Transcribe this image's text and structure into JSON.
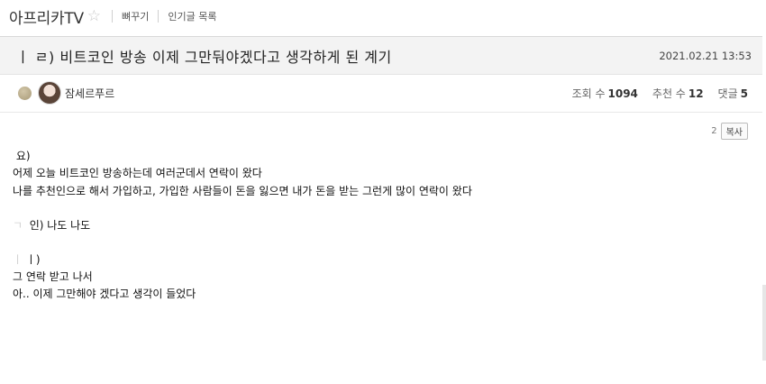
{
  "topbar": {
    "board_title": "아프리카TV",
    "star_icon": "☆",
    "links": [
      "뼈꾸기",
      "인기글 목록"
    ]
  },
  "post": {
    "title": "ㅣ  ㄹ) 비트코인 방송 이제 그만둬야겠다고 생각하게 된 계기",
    "date": "2021.02.21 13:53",
    "author": "잠세르푸르"
  },
  "stats": {
    "views_label": "조회 수",
    "views": "1094",
    "recommend_label": "추천 수",
    "recommend": "12",
    "comments_label": "댓글",
    "comments": "5"
  },
  "copy": {
    "number": "2",
    "button": "복사"
  },
  "content": {
    "lines": [
      "요)",
      "어제 오늘 비트코인 방송하는데 여러군데서 연락이 왔다",
      "나를 추천인으로 해서 가입하고, 가입한 사람들이 돈을 잃으면 내가 돈을 받는 그런게 많이 연락이 왔다",
      "인) 나도 나도",
      "ㅣ)",
      "그 연락 받고 나서",
      "아.. 이제 그만해야 겠다고 생각이 들었다"
    ],
    "ghost_a": "ㄱ",
    "ghost_b": "ㅣ"
  }
}
